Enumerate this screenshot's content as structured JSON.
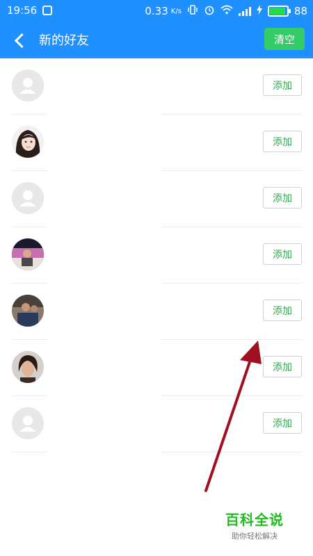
{
  "status_bar": {
    "time": "19:56",
    "speed_value": "0.33",
    "speed_unit": "K/s",
    "battery_level": "88"
  },
  "header": {
    "title": "新的好友",
    "clear_label": "清空"
  },
  "friends": [
    {
      "avatar": "default-avatar-icon",
      "button_label": "添加"
    },
    {
      "avatar": "photo-avatar",
      "button_label": "添加"
    },
    {
      "avatar": "default-avatar-icon",
      "button_label": "添加"
    },
    {
      "avatar": "photo-avatar",
      "button_label": "添加"
    },
    {
      "avatar": "photo-avatar",
      "button_label": "添加"
    },
    {
      "avatar": "photo-avatar",
      "button_label": "添加"
    },
    {
      "avatar": "default-avatar-icon",
      "button_label": "添加"
    }
  ],
  "watermark": {
    "main": "百科全说",
    "sub": "助你轻松解决"
  },
  "colors": {
    "header_bg": "#1e90ff",
    "clear_button_bg": "#33cc66",
    "add_text": "#33a853",
    "arrow": "#a01020"
  }
}
